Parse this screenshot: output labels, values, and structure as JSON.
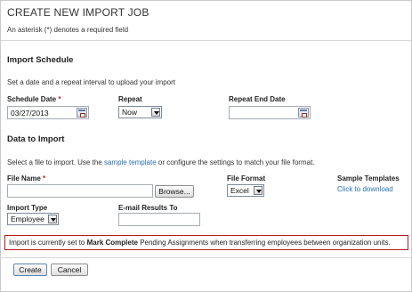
{
  "page": {
    "title": "CREATE NEW IMPORT JOB",
    "required_note": "An asterisk (*) denotes a required field"
  },
  "schedule": {
    "heading": "Import Schedule",
    "description": "Set a date and a repeat interval to upload your import",
    "schedule_date_label": "Schedule Date",
    "required_mark": "*",
    "schedule_date_value": "03/27/2013",
    "repeat_label": "Repeat",
    "repeat_value": "Now",
    "repeat_end_label": "Repeat End Date",
    "repeat_end_value": ""
  },
  "data_import": {
    "heading": "Data to Import",
    "description_prefix": "Select a file to import. Use the",
    "sample_template_link": "sample template",
    "description_suffix": "or configure the settings to match your file format.",
    "file_name_label": "File Name",
    "required_mark": "*",
    "file_name_value": "",
    "browse_label": "Browse...",
    "file_format_label": "File Format",
    "file_format_value": "Excel",
    "sample_templates_label": "Sample Templates",
    "download_link": "Click to download",
    "import_type_label": "Import Type",
    "import_type_value": "Employee",
    "email_label": "E-mail Results To",
    "email_value": ""
  },
  "notice": {
    "prefix": "Import is currently set to",
    "emphasis": "Mark Complete",
    "suffix": "Pending Assignments when transferring employees between organization units."
  },
  "actions": {
    "create_label": "Create",
    "cancel_label": "Cancel"
  }
}
